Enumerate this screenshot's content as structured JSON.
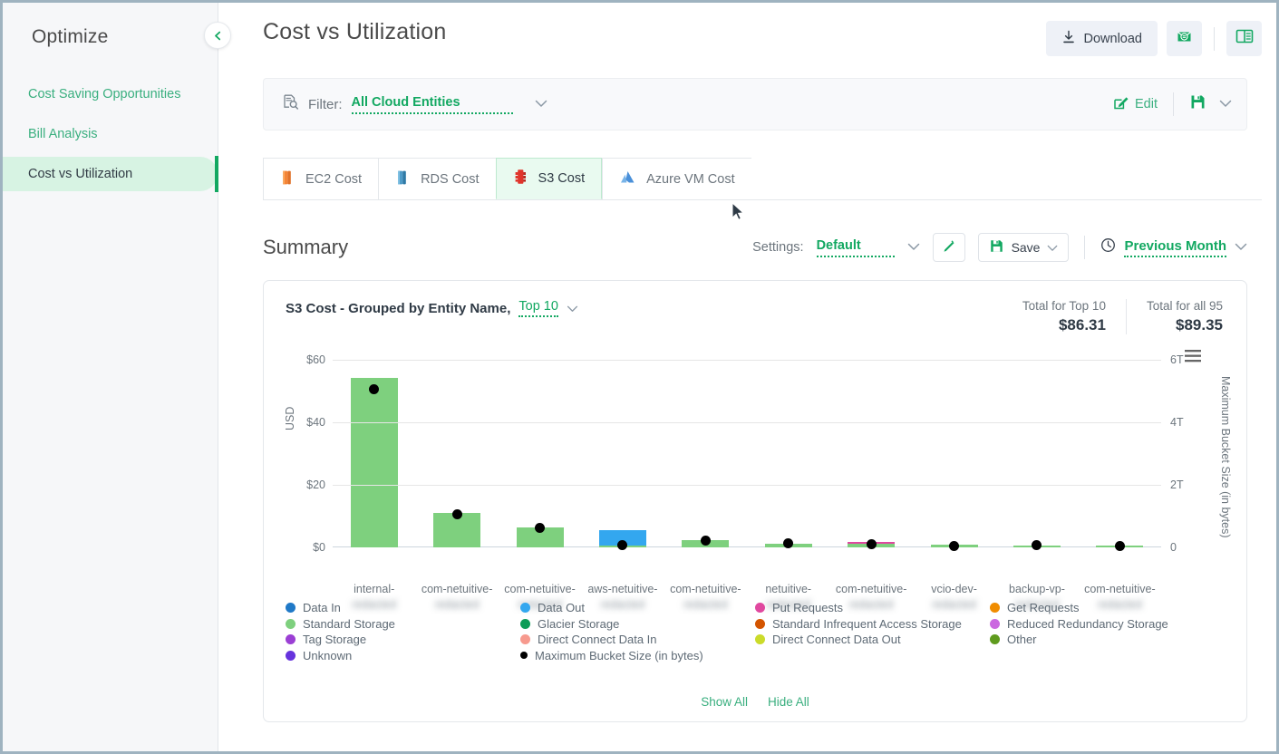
{
  "sidebar": {
    "title": "Optimize",
    "collapse_icon": "chevron-left-icon",
    "items": [
      {
        "label": "Cost Saving Opportunities",
        "active": false
      },
      {
        "label": "Bill Analysis",
        "active": false
      },
      {
        "label": "Cost vs Utilization",
        "active": true
      }
    ]
  },
  "header": {
    "title": "Cost vs Utilization",
    "download_label": "Download",
    "download_icon": "download-icon",
    "email_icon": "email-report-icon",
    "book_icon": "book-view-icon"
  },
  "filter": {
    "icon": "filter-document-icon",
    "label": "Filter:",
    "value": "All Cloud Entities",
    "chevron_icon": "chevron-down-icon",
    "edit_label": "Edit",
    "edit_icon": "edit-pencil-icon",
    "save_icon": "save-disk-icon",
    "save_caret_icon": "chevron-down-icon"
  },
  "tabs": [
    {
      "label": "EC2 Cost",
      "icon": "ec2-icon",
      "color": "#F58536",
      "active": false
    },
    {
      "label": "RDS Cost",
      "icon": "rds-icon",
      "color": "#3B8DBD",
      "active": false
    },
    {
      "label": "S3 Cost",
      "icon": "s3-icon",
      "color": "#E0342B",
      "active": true
    },
    {
      "label": "Azure VM Cost",
      "icon": "azure-vm-icon",
      "color": "#4A90D9",
      "active": false
    }
  ],
  "summary": {
    "title": "Summary",
    "settings_label": "Settings:",
    "settings_value": "Default",
    "settings_chevron_icon": "chevron-down-icon",
    "edit_icon": "edit-pencil-icon",
    "save_label": "Save",
    "save_icon": "save-disk-icon",
    "save_caret_icon": "chevron-down-icon",
    "time_icon": "clock-icon",
    "time_value": "Previous Month",
    "time_chevron_icon": "chevron-down-icon"
  },
  "card": {
    "title": "S3 Cost - Grouped by Entity Name,",
    "top_n": "Top 10",
    "top_n_chevron_icon": "chevron-down-icon",
    "menu_icon": "hamburger-menu-icon",
    "totals": [
      {
        "label": "Total for Top 10",
        "value": "$86.31"
      },
      {
        "label": "Total for all 95",
        "value": "$89.35"
      }
    ],
    "show_all": "Show All",
    "hide_all": "Hide All"
  },
  "colors": {
    "accent_green": "#12a861",
    "link_green": "#3aaf7f",
    "active_bg": "#d7f3e3",
    "standard_storage": "#7ed07e",
    "data_out": "#33a7ef",
    "put_requests": "#e0489f",
    "marker_black": "#000000"
  },
  "chart_data": {
    "type": "bar",
    "title": "S3 Cost - Grouped by Entity Name, Top 10",
    "xlabel": "",
    "ylabel": "USD",
    "y2label": "Maximum Bucket Size (in bytes)",
    "ylim": [
      0,
      60
    ],
    "yticks": [
      "$0",
      "$20",
      "$40",
      "$60"
    ],
    "ytick_values": [
      0,
      20,
      40,
      60
    ],
    "y2lim": [
      0,
      6
    ],
    "y2ticks": [
      "0",
      "2T",
      "4T",
      "6T"
    ],
    "y2tick_values": [
      0,
      2,
      4,
      6
    ],
    "grid": true,
    "legend_position": "bottom",
    "categories": [
      "internal-",
      "com-netuitive-",
      "com-netuitive-",
      "aws-netuitive-",
      "com-netuitive-",
      "netuitive-",
      "com-netuitive-",
      "vcio-dev-",
      "backup-vp-",
      "com-netuitive-"
    ],
    "series": [
      {
        "name": "Standard Storage",
        "color": "#7ed07e",
        "values": [
          54.2,
          11.0,
          6.4,
          0.5,
          2.2,
          1.3,
          1.3,
          0.9,
          0.3,
          0.4,
          0.3
        ]
      },
      {
        "name": "Data Out",
        "color": "#33a7ef",
        "values": [
          0,
          0,
          0,
          4.9,
          0,
          0,
          0,
          0,
          0,
          0
        ]
      },
      {
        "name": "Put Requests",
        "color": "#e0489f",
        "values": [
          0,
          0,
          0,
          0,
          0,
          0,
          0.45,
          0,
          0,
          0
        ]
      }
    ],
    "marker_series": {
      "name": "Maximum Bucket Size (in bytes)",
      "color": "#000000",
      "y_axis": "right",
      "values": [
        5.05,
        1.05,
        0.62,
        0.07,
        0.23,
        0.13,
        0.09,
        0.05,
        0.06,
        0.04
      ]
    },
    "legend": [
      {
        "label": "Data In",
        "color": "#2079c7"
      },
      {
        "label": "Data Out",
        "color": "#33a7ef"
      },
      {
        "label": "Put Requests",
        "color": "#e0489f"
      },
      {
        "label": "Get Requests",
        "color": "#f08c00"
      },
      {
        "label": "Standard Storage",
        "color": "#7ed07e"
      },
      {
        "label": "Glacier Storage",
        "color": "#0e9c57"
      },
      {
        "label": "Standard Infrequent Access Storage",
        "color": "#d35400"
      },
      {
        "label": "Reduced Redundancy Storage",
        "color": "#cb68e0"
      },
      {
        "label": "Tag Storage",
        "color": "#9b3fd4"
      },
      {
        "label": "Direct Connect Data In",
        "color": "#f79a8e"
      },
      {
        "label": "Direct Connect Data Out",
        "color": "#cbdb2a"
      },
      {
        "label": "Other",
        "color": "#5f9b1e"
      },
      {
        "label": "Unknown",
        "color": "#6633dd"
      },
      {
        "label": "Maximum Bucket Size (in bytes)",
        "color": "#000000",
        "marker": "dot"
      }
    ]
  }
}
